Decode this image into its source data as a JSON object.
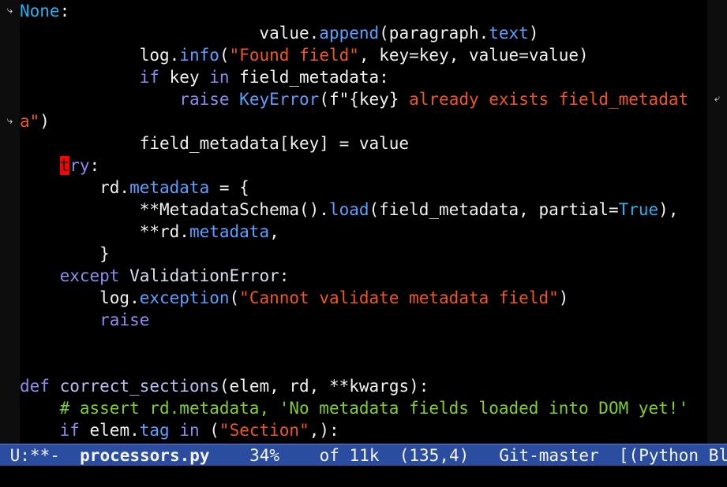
{
  "editor": {
    "lines": [
      [
        {
          "t": "None",
          "c": "constant"
        },
        {
          "t": ":",
          "c": "default"
        }
      ],
      [
        {
          "t": "                        value.",
          "c": "default"
        },
        {
          "t": "append",
          "c": "builtin"
        },
        {
          "t": "(paragraph.",
          "c": "default"
        },
        {
          "t": "text",
          "c": "builtin"
        },
        {
          "t": ")",
          "c": "default"
        }
      ],
      [
        {
          "t": "            log.",
          "c": "default"
        },
        {
          "t": "info",
          "c": "builtin"
        },
        {
          "t": "(",
          "c": "default"
        },
        {
          "t": "\"Found field\"",
          "c": "string"
        },
        {
          "t": ", key=key, value=value)",
          "c": "default"
        }
      ],
      [
        {
          "t": "            ",
          "c": "default"
        },
        {
          "t": "if",
          "c": "keyword"
        },
        {
          "t": " key ",
          "c": "default"
        },
        {
          "t": "in",
          "c": "keyword"
        },
        {
          "t": " field_metadata:",
          "c": "default"
        }
      ],
      [
        {
          "t": "                ",
          "c": "default"
        },
        {
          "t": "raise",
          "c": "keyword"
        },
        {
          "t": " ",
          "c": "default"
        },
        {
          "t": "KeyError",
          "c": "builtin"
        },
        {
          "t": "(f\"{key}",
          "c": "default"
        },
        {
          "t": " already exists field_metadat",
          "c": "string"
        }
      ],
      [
        {
          "t": "a\"",
          "c": "string"
        },
        {
          "t": ")",
          "c": "default"
        }
      ],
      [
        {
          "t": "            field_metadata[key] = value",
          "c": "default"
        }
      ],
      [
        {
          "t": "    ",
          "c": "default"
        },
        {
          "t": "t",
          "c": "cursor"
        },
        {
          "t": "ry",
          "c": "keyword"
        },
        {
          "t": ":",
          "c": "default"
        }
      ],
      [
        {
          "t": "        rd.",
          "c": "default"
        },
        {
          "t": "metadata",
          "c": "builtin"
        },
        {
          "t": " = {",
          "c": "default"
        }
      ],
      [
        {
          "t": "            **MetadataSchema().",
          "c": "default"
        },
        {
          "t": "load",
          "c": "builtin"
        },
        {
          "t": "(field_metadata, partial=",
          "c": "default"
        },
        {
          "t": "True",
          "c": "constant"
        },
        {
          "t": "),",
          "c": "default"
        }
      ],
      [
        {
          "t": "            **rd.",
          "c": "default"
        },
        {
          "t": "metadata",
          "c": "builtin"
        },
        {
          "t": ",",
          "c": "default"
        }
      ],
      [
        {
          "t": "        }",
          "c": "default"
        }
      ],
      [
        {
          "t": "    ",
          "c": "default"
        },
        {
          "t": "except",
          "c": "keyword"
        },
        {
          "t": " ValidationError:",
          "c": "type"
        }
      ],
      [
        {
          "t": "        log.",
          "c": "default"
        },
        {
          "t": "exception",
          "c": "builtin"
        },
        {
          "t": "(",
          "c": "default"
        },
        {
          "t": "\"Cannot validate metadata field\"",
          "c": "string"
        },
        {
          "t": ")",
          "c": "default"
        }
      ],
      [
        {
          "t": "        ",
          "c": "default"
        },
        {
          "t": "raise",
          "c": "keyword"
        }
      ],
      [],
      [],
      [
        {
          "t": "def",
          "c": "keyword"
        },
        {
          "t": " ",
          "c": "default"
        },
        {
          "t": "correct_sections",
          "c": "funcname"
        },
        {
          "t": "(elem, rd, **kwargs):",
          "c": "default"
        }
      ],
      [
        {
          "t": "    ",
          "c": "default"
        },
        {
          "t": "# assert rd.metadata, 'No metadata fields loaded into DOM yet!'",
          "c": "comment"
        }
      ],
      [
        {
          "t": "    ",
          "c": "default"
        },
        {
          "t": "if",
          "c": "keyword"
        },
        {
          "t": " elem.",
          "c": "default"
        },
        {
          "t": "tag",
          "c": "builtin"
        },
        {
          "t": " ",
          "c": "default"
        },
        {
          "t": "in",
          "c": "keyword"
        },
        {
          "t": " (",
          "c": "default"
        },
        {
          "t": "\"Section\"",
          "c": "string"
        },
        {
          "t": ",):",
          "c": "default"
        }
      ]
    ]
  },
  "fringe": {
    "wrap_glyph": "⤶",
    "continue_glyph": "⤷"
  },
  "modeline": {
    "status": " U:**-  ",
    "buffer": "processors.py",
    "position": "    34%    of 11k  (135,4)   ",
    "vc": "Git-master",
    "mode": "  [(Python Bl"
  }
}
